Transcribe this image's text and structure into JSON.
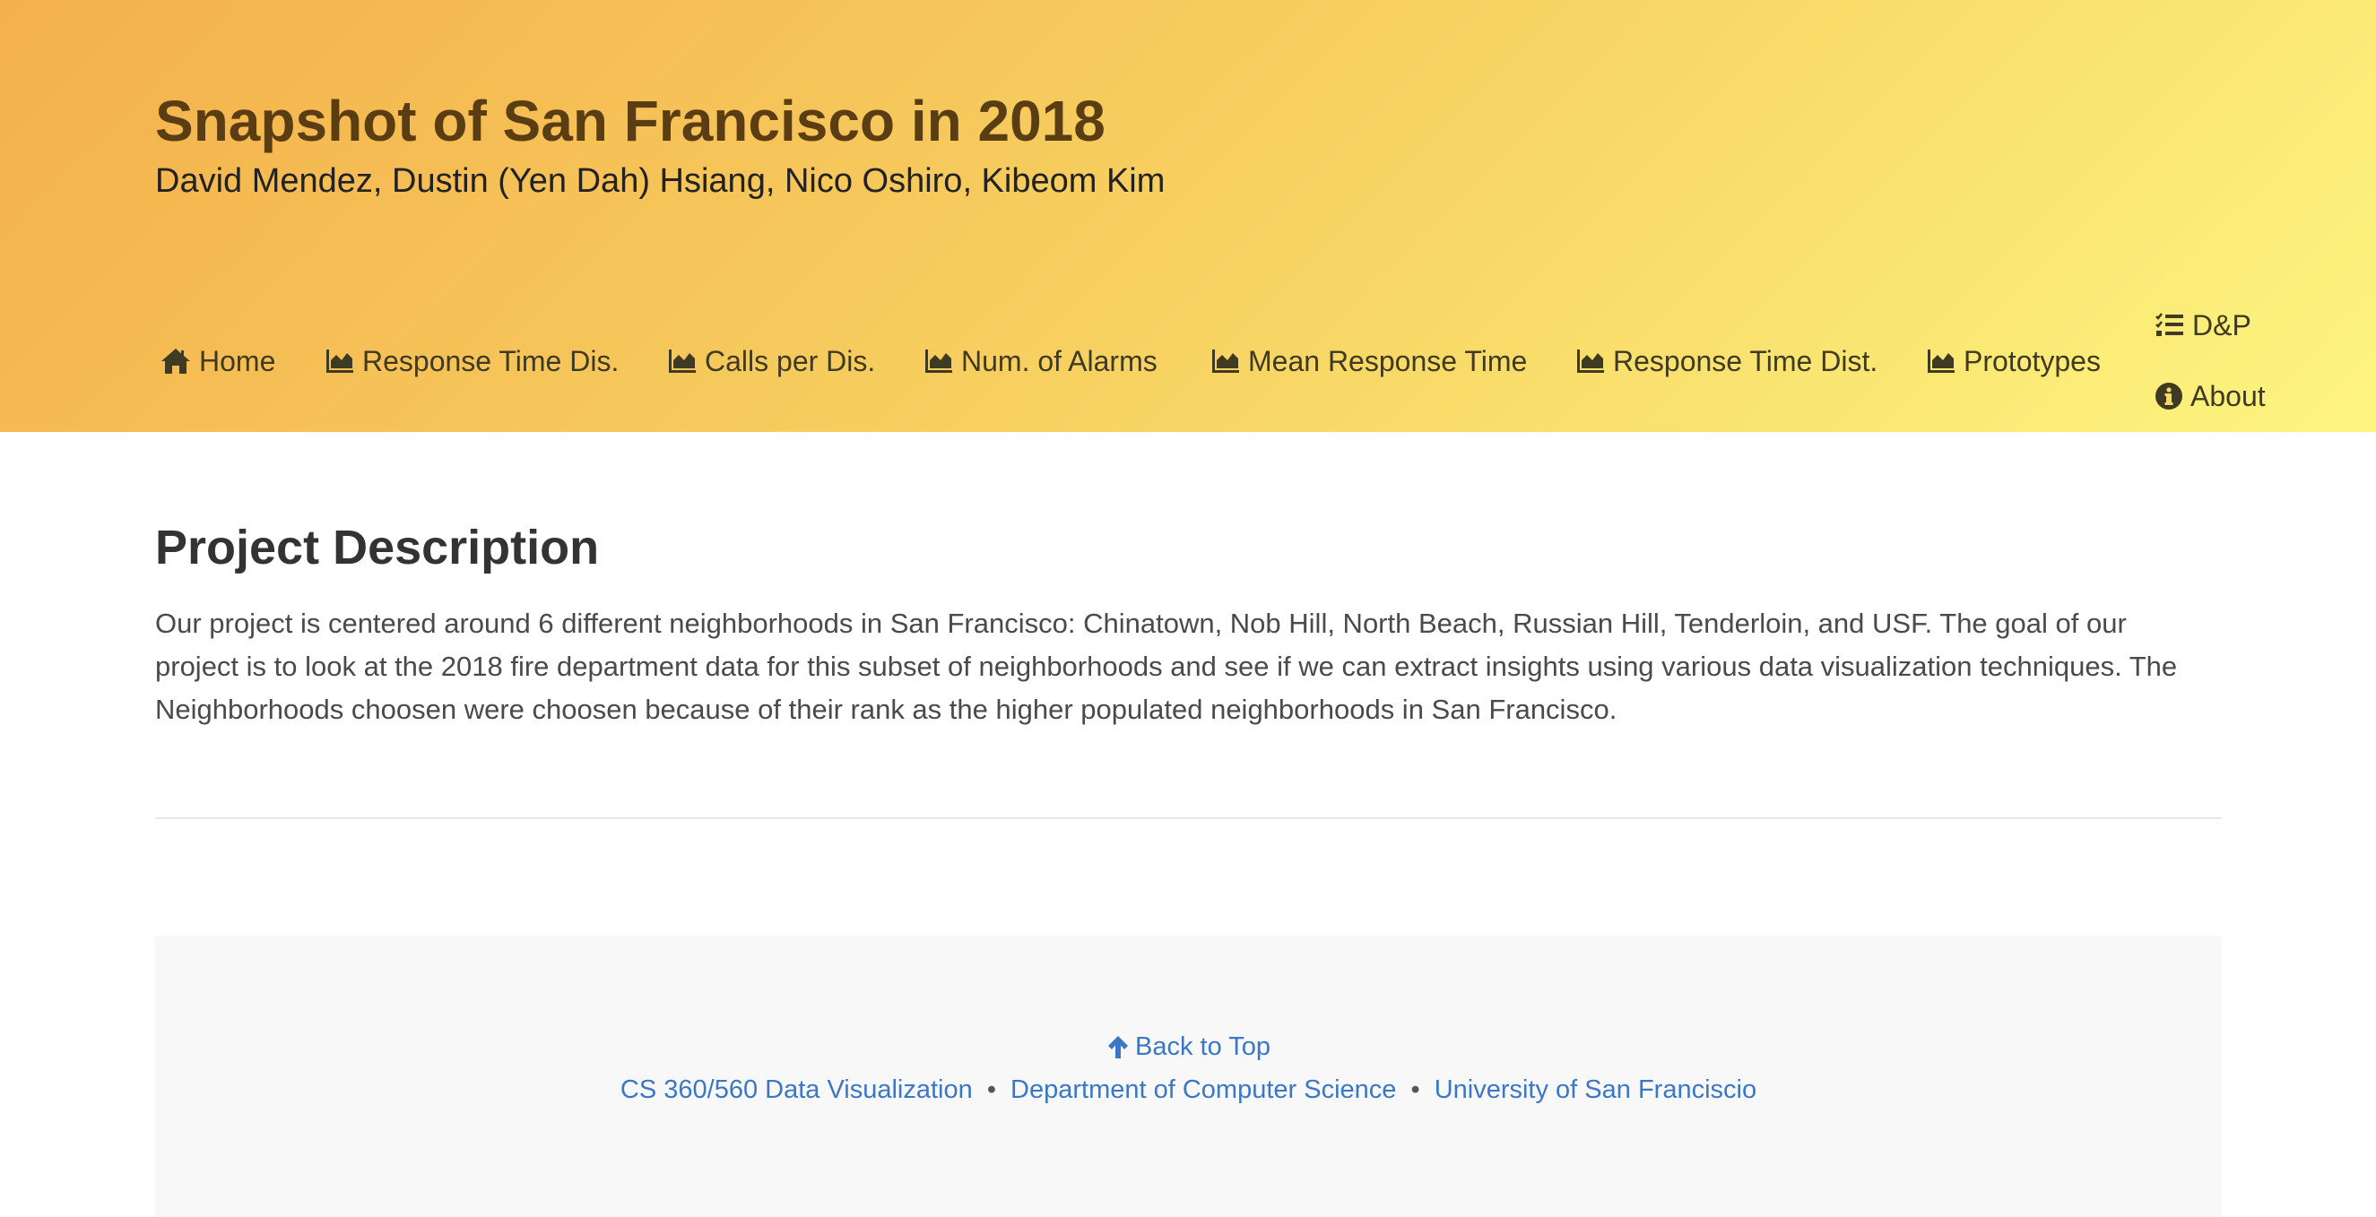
{
  "header": {
    "title": "Snapshot of San Francisco in 2018",
    "authors": "David Mendez, Dustin (Yen Dah) Hsiang, Nico Oshiro, Kibeom Kim"
  },
  "nav": {
    "items": [
      {
        "label": "Home",
        "icon": "home-icon"
      },
      {
        "label": "Response Time Dis.",
        "icon": "area-chart-icon"
      },
      {
        "label": "Calls per Dis.",
        "icon": "area-chart-icon"
      },
      {
        "label": "Num. of Alarms",
        "icon": "area-chart-icon"
      },
      {
        "label": "Mean Response Time",
        "icon": "area-chart-icon"
      },
      {
        "label": "Response Time Dist.",
        "icon": "area-chart-icon"
      },
      {
        "label": "Prototypes",
        "icon": "area-chart-icon"
      },
      {
        "label": "D&P",
        "icon": "tasks-icon"
      },
      {
        "label": "About",
        "icon": "info-circle-icon"
      }
    ]
  },
  "main": {
    "section_title": "Project Description",
    "description": "Our project is centered around 6 different neighborhoods in San Francisco: Chinatown, Nob Hill, North Beach, Russian Hill, Tenderloin, and USF. The goal of our project is to look at the 2018 fire department data for this subset of neighborhoods and see if we can extract insights using various data visualization techniques. The Neighborhoods choosen were choosen because of their rank as the higher populated neighborhoods in San Francisco."
  },
  "footer": {
    "back_to_top": "Back to Top",
    "course_link": "CS 360/560 Data Visualization",
    "separator": "•",
    "department_link": "Department of Computer Science",
    "university_link": "University of San Franciscio"
  },
  "colors": {
    "header_gradient_start": "#f4b04c",
    "header_gradient_end": "#fdf580",
    "title_color": "#5a3d12",
    "link_color": "#3a78c7",
    "footer_bg": "#f8f8f8"
  }
}
